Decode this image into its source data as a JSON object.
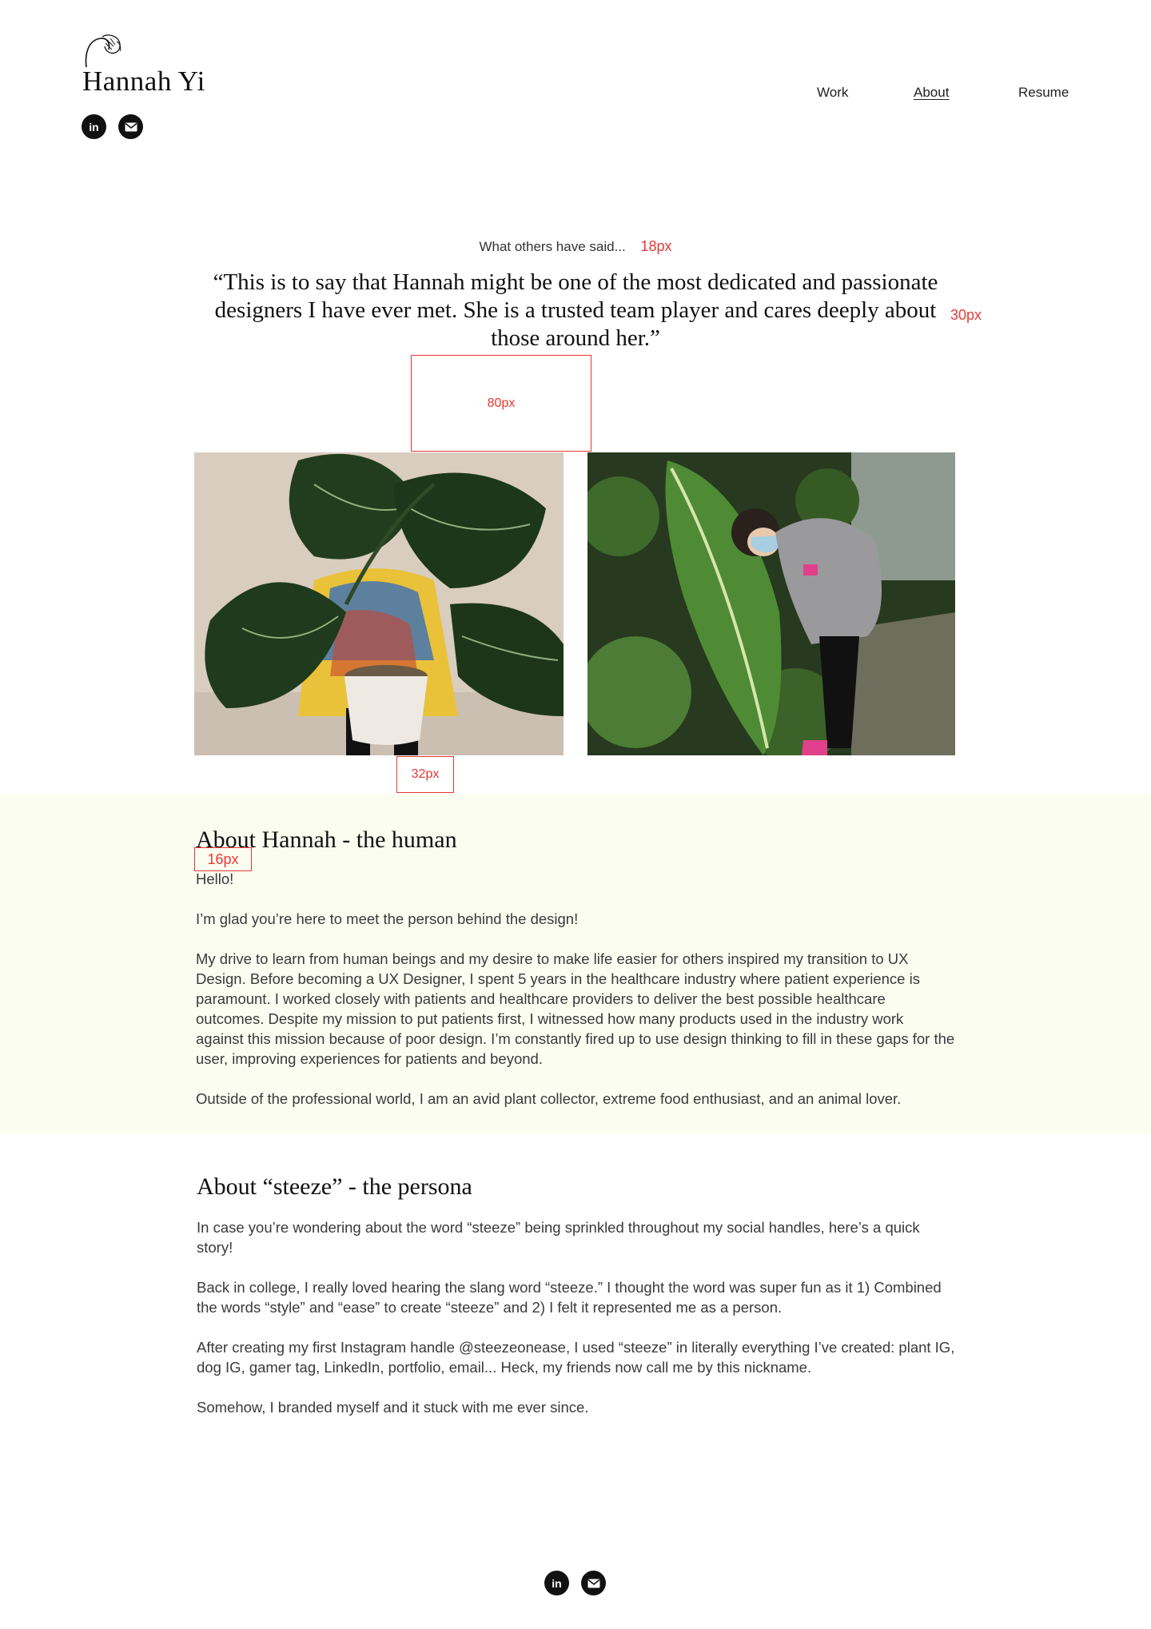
{
  "header": {
    "name": "Hannah Yi",
    "social": [
      {
        "icon": "linkedin-icon",
        "label": "in"
      },
      {
        "icon": "email-icon",
        "label": ""
      }
    ],
    "nav": [
      {
        "label": "Work",
        "active": false
      },
      {
        "label": "About",
        "active": true
      },
      {
        "label": "Resume",
        "active": false
      }
    ]
  },
  "testimonial": {
    "kicker": "What others have said...",
    "quote": "“This is to say that Hannah might be one of the most dedicated and passionate designers I have ever met. She is a trusted team player and cares deeply about those around her.”"
  },
  "annotations": {
    "kicker_size": "18px",
    "quote_size": "30px",
    "gap_quote_photos": "80px",
    "gap_photos_section": "32px",
    "gap_heading_body": "16px"
  },
  "photos": [
    {
      "alt": "Hannah holding a large potted philodendron in front of her face"
    },
    {
      "alt": "Hannah in a mask posing beside a giant leaf in a greenhouse"
    }
  ],
  "about_human": {
    "title": "About Hannah - the human",
    "paragraphs": [
      "Hello!",
      "I’m glad you’re here to meet the person behind the design!",
      "My drive to learn from human beings and my desire to make life easier for others inspired my transition to UX Design. Before becoming a UX Designer, I spent 5 years in the healthcare industry where patient experience is paramount. I worked closely with patients and healthcare providers to deliver the best possible healthcare outcomes. Despite my mission to put patients first, I witnessed how many products used in the industry work against this mission because of poor design. I’m constantly fired up to use design thinking to fill in these gaps for the user, improving experiences for patients and beyond.",
      "Outside of the professional world, I am an avid plant collector, extreme food enthusiast, and an animal lover."
    ]
  },
  "about_persona": {
    "title": "About “steeze” - the persona",
    "paragraphs": [
      "In case you’re wondering about the word “steeze” being sprinkled throughout my social handles, here’s a quick story!",
      "Back in college, I really loved hearing the slang word “steeze.” I thought the word was super fun as it 1) Combined the words “style” and “ease” to create “steeze” and 2) I felt it represented me as a person.",
      "After creating my first Instagram handle @steezeonease, I used “steeze” in literally everything I’ve created: plant IG, dog IG, gamer tag, LinkedIn, portfolio, email... Heck, my friends now call me by this nickname.",
      "Somehow, I branded myself and it stuck with me ever since."
    ]
  },
  "colors": {
    "band_bg": "#fbfdf1",
    "annotation": "#e53935",
    "text": "#111111"
  }
}
